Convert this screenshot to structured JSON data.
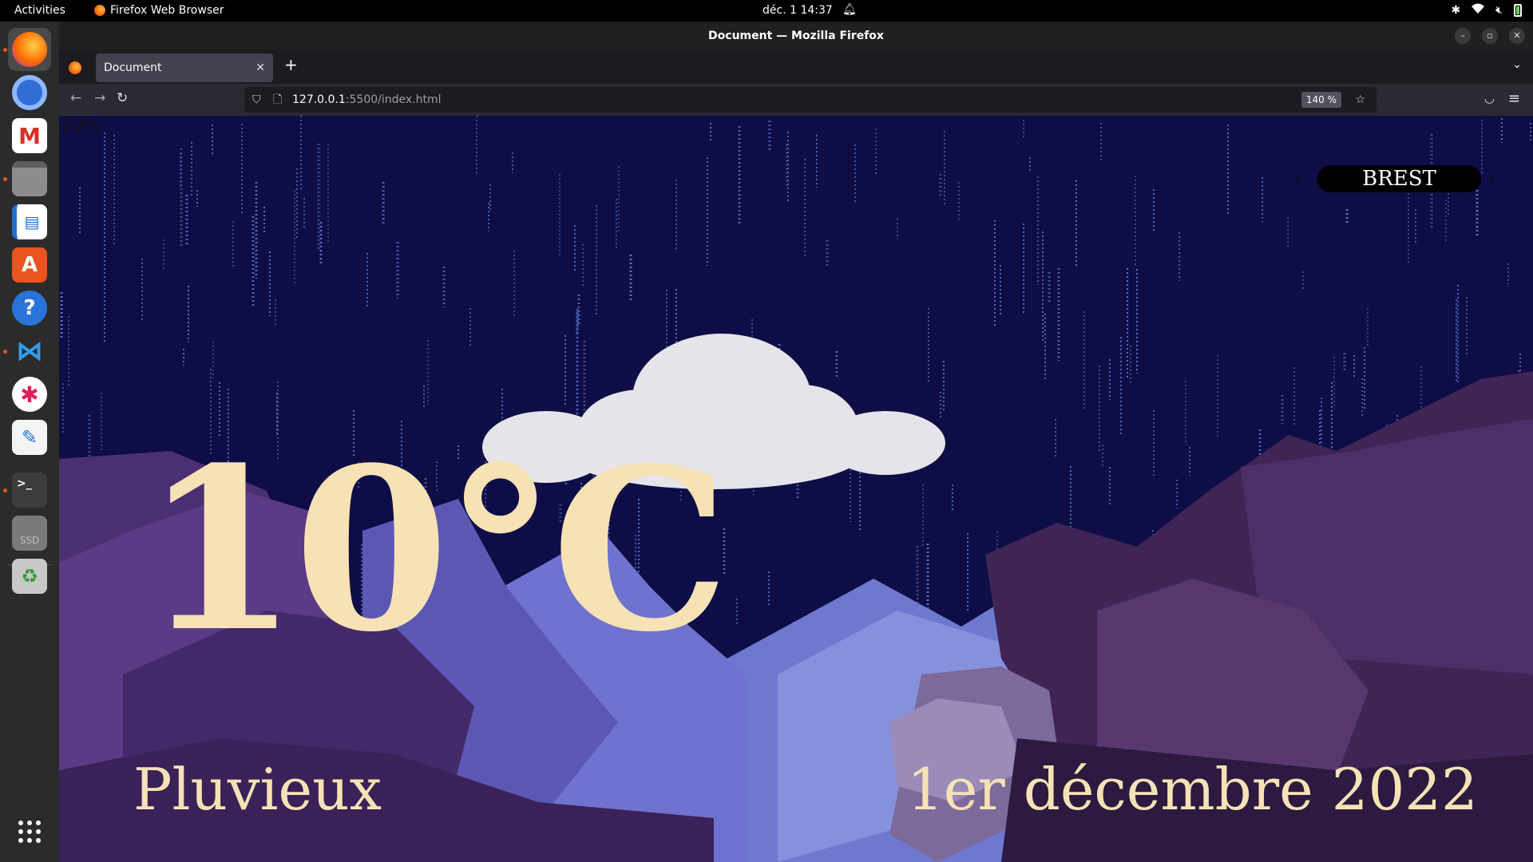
{
  "topbar": {
    "activities": "Activities",
    "app_name": "Firefox Web Browser",
    "clock": "déc. 1  14:37"
  },
  "dock": {
    "apps": [
      "firefox",
      "chromium",
      "gmail",
      "files",
      "writer",
      "app-center",
      "help",
      "vscode",
      "slack",
      "text-editor",
      "terminal",
      "ssd-drive",
      "trash",
      "show-apps"
    ]
  },
  "browser": {
    "window_title": "Document — Mozilla Firefox",
    "tab_title": "Document",
    "url_host": "127.0.0.1",
    "url_rest": ":5500/index.html",
    "zoom": "140 %"
  },
  "weather": {
    "loading_text": "10%",
    "city": "BREST",
    "prev_arrow": "‹",
    "next_arrow": "›",
    "temperature": "10°C",
    "condition": "Pluvieux",
    "date": "1er décembre 2022"
  },
  "colors": {
    "sky": "#0f0d45",
    "rain": "#5a7fd6",
    "text_cream": "#f7e2b6",
    "cloud": "#e4e4ea",
    "rock_dark": "#2e1a3e",
    "rock_mid": "#5b3a7a",
    "mountain_light": "#7b86d8",
    "accent_orange": "#e95420"
  }
}
